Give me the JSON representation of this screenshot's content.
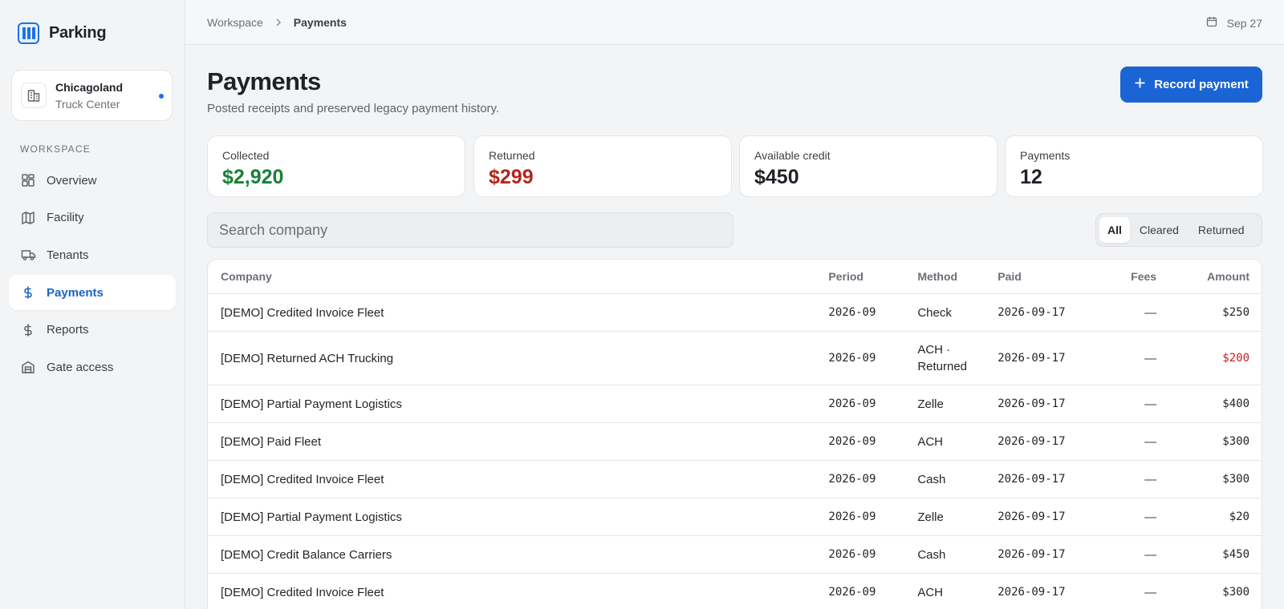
{
  "app": {
    "name": "Parking"
  },
  "org": {
    "name": "Chicagoland",
    "sub": "Truck Center"
  },
  "sidebar": {
    "section_label": "WORKSPACE",
    "items": [
      {
        "label": "Overview",
        "icon": "grid-icon",
        "active": false
      },
      {
        "label": "Facility",
        "icon": "map-icon",
        "active": false
      },
      {
        "label": "Tenants",
        "icon": "truck-icon",
        "active": false
      },
      {
        "label": "Payments",
        "icon": "dollar-icon",
        "active": true
      },
      {
        "label": "Reports",
        "icon": "dollar-icon",
        "active": false
      },
      {
        "label": "Gate access",
        "icon": "gate-icon",
        "active": false
      }
    ]
  },
  "breadcrumb": {
    "root": "Workspace",
    "current": "Payments"
  },
  "topbar": {
    "date": "Sep 27"
  },
  "page": {
    "title": "Payments",
    "subtitle": "Posted receipts and preserved legacy payment history.",
    "record_button": "Record payment"
  },
  "stats": [
    {
      "label": "Collected",
      "value": "$2,920",
      "color": "#188038"
    },
    {
      "label": "Returned",
      "value": "$299",
      "color": "#b3261e"
    },
    {
      "label": "Available credit",
      "value": "$450",
      "color": "#1f2328"
    },
    {
      "label": "Payments",
      "value": "12",
      "color": "#1f2328"
    }
  ],
  "search": {
    "placeholder": "Search company"
  },
  "filters": {
    "all": "All",
    "cleared": "Cleared",
    "returned": "Returned",
    "selected": "All"
  },
  "table": {
    "headers": {
      "company": "Company",
      "period": "Period",
      "method": "Method",
      "paid": "Paid",
      "fees": "Fees",
      "amount": "Amount"
    },
    "rows": [
      {
        "company": "[DEMO] Credited Invoice Fleet",
        "period": "2026-09",
        "method": "Check",
        "paid": "2026-09-17",
        "fees": "—",
        "amount": "$250"
      },
      {
        "company": "[DEMO] Returned ACH Trucking",
        "period": "2026-09",
        "method": "ACH ·",
        "method2": "Returned",
        "paid": "2026-09-17",
        "fees": "—",
        "amount": "$200"
      },
      {
        "company": "[DEMO] Partial Payment Logistics",
        "period": "2026-09",
        "method": "Zelle",
        "paid": "2026-09-17",
        "fees": "—",
        "amount": "$400"
      },
      {
        "company": "[DEMO] Paid Fleet",
        "period": "2026-09",
        "method": "ACH",
        "paid": "2026-09-17",
        "fees": "—",
        "amount": "$300"
      },
      {
        "company": "[DEMO] Credited Invoice Fleet",
        "period": "2026-09",
        "method": "Cash",
        "paid": "2026-09-17",
        "fees": "—",
        "amount": "$300"
      },
      {
        "company": "[DEMO] Partial Payment Logistics",
        "period": "2026-09",
        "method": "Zelle",
        "paid": "2026-09-17",
        "fees": "—",
        "amount": "$20"
      },
      {
        "company": "[DEMO] Credit Balance Carriers",
        "period": "2026-09",
        "method": "Cash",
        "paid": "2026-09-17",
        "fees": "—",
        "amount": "$450"
      },
      {
        "company": "[DEMO] Credited Invoice Fleet",
        "period": "2026-09",
        "method": "ACH",
        "paid": "2026-09-17",
        "fees": "—",
        "amount": "$300"
      }
    ]
  }
}
